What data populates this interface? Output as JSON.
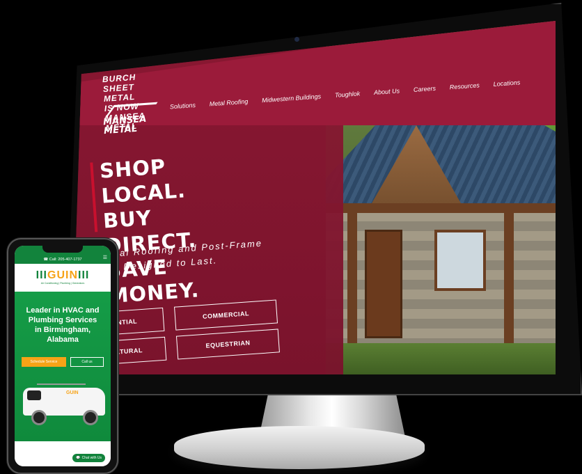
{
  "desktop_site": {
    "banner": "BURCH SHEET METAL IS NOW MANSEA METAL",
    "logo": {
      "line1": "MANSEA",
      "line2": "METAL"
    },
    "nav": [
      "Solutions",
      "Metal Roofing",
      "Midwestern Buildings",
      "Toughlok",
      "About Us",
      "Careers",
      "Resources",
      "Locations"
    ],
    "headline": [
      "SHOP LOCAL.",
      "BUY DIRECT.",
      "SAVE MONEY."
    ],
    "subhead_line1": "Metal Roofing and Post-Frame",
    "subhead_line2": "ings Designed to Last.",
    "buttons": {
      "residential": "ENTIAL",
      "commercial": "COMMERCIAL",
      "agricultural": "ULTURAL",
      "equestrian": "EQUESTRIAN"
    },
    "colors": {
      "primary": "#9b1b3a",
      "accent": "#c8102e"
    }
  },
  "mobile_site": {
    "call_text": "Call: 205-407-1737",
    "logo": "GUIN",
    "tagline": "Air Conditioning | Plumbing | Generators",
    "headline": [
      "Leader in HVAC and",
      "Plumbing Services",
      "in Birmingham, Alabama"
    ],
    "schedule_button": "Schedule Service",
    "call_button": "Call us",
    "van_logo": "GUIN",
    "chat_button": "Chat with Us",
    "colors": {
      "green": "#12833c",
      "orange": "#f6a317"
    }
  }
}
